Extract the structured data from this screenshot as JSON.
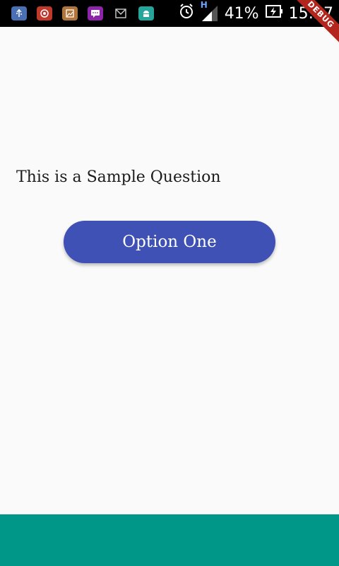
{
  "status_bar": {
    "notification_icons": [
      {
        "name": "usb-icon",
        "color": "#4a6fb3"
      },
      {
        "name": "record-icon",
        "color": "#c0392b"
      },
      {
        "name": "gallery-icon",
        "color": "#b0753a"
      },
      {
        "name": "message-icon",
        "color": "#8e24aa"
      },
      {
        "name": "mail-icon",
        "color": "#9e9e9e"
      },
      {
        "name": "android-icon",
        "color": "#26a69a"
      }
    ],
    "network_type": "H",
    "battery_percent": "41%",
    "time": "15:27"
  },
  "debug_banner": "DEBUG",
  "main": {
    "question": "This is a Sample Question",
    "option_one": "Option One"
  },
  "colors": {
    "accent": "#3f51b5",
    "bottom_bar": "#009688",
    "background": "#fafafa"
  }
}
